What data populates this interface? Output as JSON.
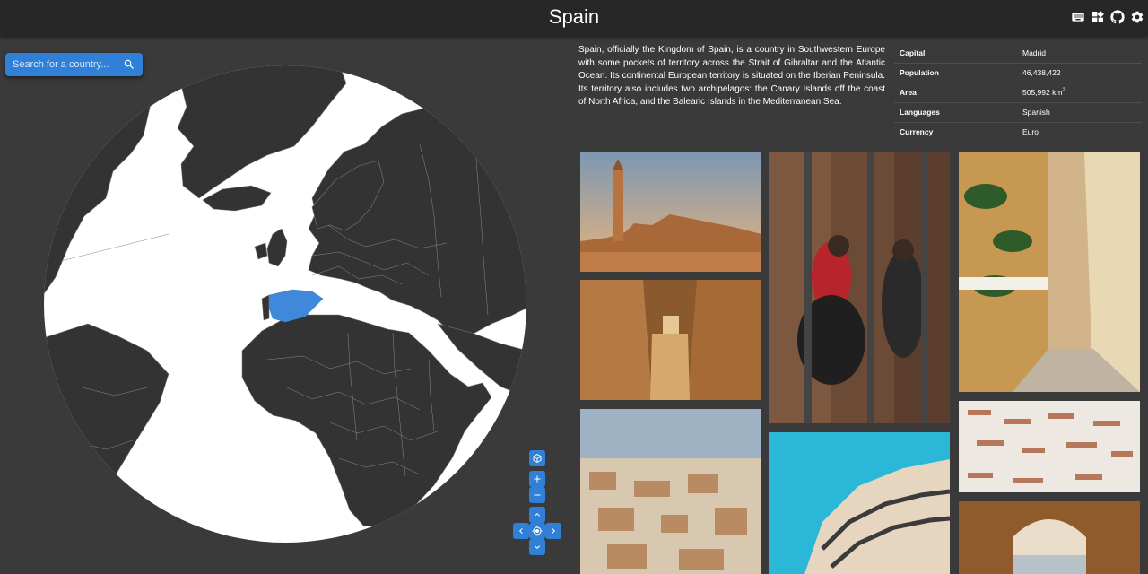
{
  "header": {
    "title": "Spain"
  },
  "icons": {
    "header_icons": [
      "keyboard-icon",
      "widgets-icon",
      "github-icon",
      "settings-icon"
    ],
    "search": "search-icon",
    "controls": [
      "cube-icon",
      "plus-icon",
      "minus-icon",
      "chevron-up-icon",
      "chevron-left-icon",
      "center-icon",
      "chevron-right-icon",
      "chevron-down-icon"
    ]
  },
  "search": {
    "placeholder": "Search for a country..."
  },
  "country": {
    "description": "Spain, officially the Kingdom of Spain, is a country in Southwestern Europe with some pockets of territory across the Strait of Gibraltar and the Atlantic Ocean. Its continental European territory is situated on the Iberian Peninsula. Its territory also includes two archipelagos: the Canary Islands off the coast of North Africa, and the Balearic Islands in the Mediterranean Sea.",
    "facts": {
      "capital": {
        "label": "Capital",
        "value": "Madrid"
      },
      "population": {
        "label": "Population",
        "value": "46,438,422"
      },
      "area": {
        "label": "Area",
        "value": "505,992 km",
        "unit_sup": "2"
      },
      "languages": {
        "label": "Languages",
        "value": "Spanish"
      },
      "currency": {
        "label": "Currency",
        "value": "Euro"
      }
    }
  },
  "colors": {
    "topbar": "#272727",
    "background": "#3a3a3a",
    "accent": "#2f80d6",
    "highlight_country": "#3f88da",
    "land": "#333333",
    "ocean": "#ffffff"
  }
}
